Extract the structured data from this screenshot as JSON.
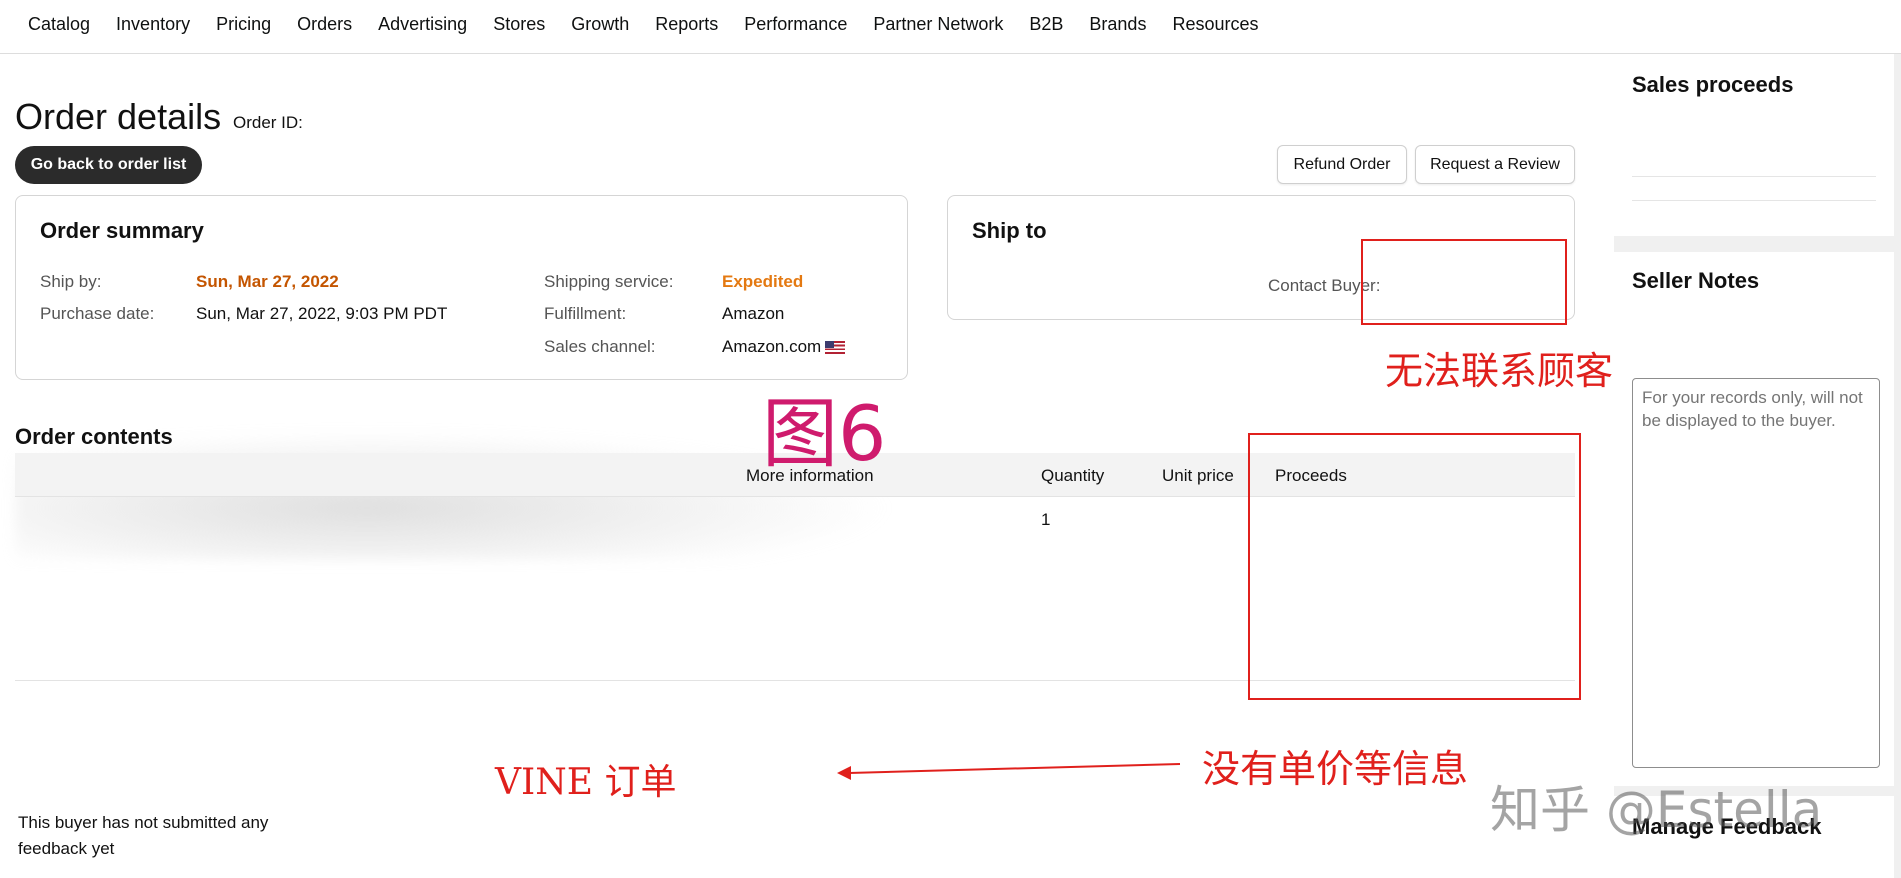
{
  "nav": {
    "items": [
      "Catalog",
      "Inventory",
      "Pricing",
      "Orders",
      "Advertising",
      "Stores",
      "Growth",
      "Reports",
      "Performance",
      "Partner Network",
      "B2B",
      "Brands",
      "Resources"
    ]
  },
  "header": {
    "title": "Order details",
    "order_id_label": "Order ID:",
    "back_button": "Go back to order list",
    "refund_button": "Refund Order",
    "review_button": "Request a Review"
  },
  "summary": {
    "title": "Order summary",
    "ship_by_label": "Ship by:",
    "ship_by_value": "Sun, Mar 27, 2022",
    "purchase_date_label": "Purchase date:",
    "purchase_date_value": "Sun, Mar 27, 2022, 9:03 PM PDT",
    "shipping_service_label": "Shipping service:",
    "shipping_service_value": "Expedited",
    "fulfillment_label": "Fulfillment:",
    "fulfillment_value": "Amazon",
    "sales_channel_label": "Sales channel:",
    "sales_channel_value": "Amazon.com",
    "flag_icon": "us-flag-icon"
  },
  "ship_to": {
    "title": "Ship to",
    "contact_buyer_label": "Contact Buyer:"
  },
  "contents": {
    "title": "Order contents",
    "columns": {
      "more_info": "More information",
      "quantity": "Quantity",
      "unit_price": "Unit price",
      "proceeds": "Proceeds"
    },
    "rows": [
      {
        "quantity": "1"
      }
    ]
  },
  "sidebar": {
    "sales_proceeds_title": "Sales proceeds",
    "seller_notes_title": "Seller Notes",
    "seller_notes_placeholder": "For your records only, will not be displayed to the buyer.",
    "manage_feedback_title": "Manage Feedback",
    "feedback_text": "This buyer has not submitted any feedback yet"
  },
  "annotations": {
    "figure_label": "图6",
    "cannot_contact": "无法联系顾客",
    "no_unit_price": "没有单价等信息",
    "vine_order": "VINE 订单",
    "watermark": "知乎 @Estella",
    "annotation_color": "#e0201c"
  }
}
